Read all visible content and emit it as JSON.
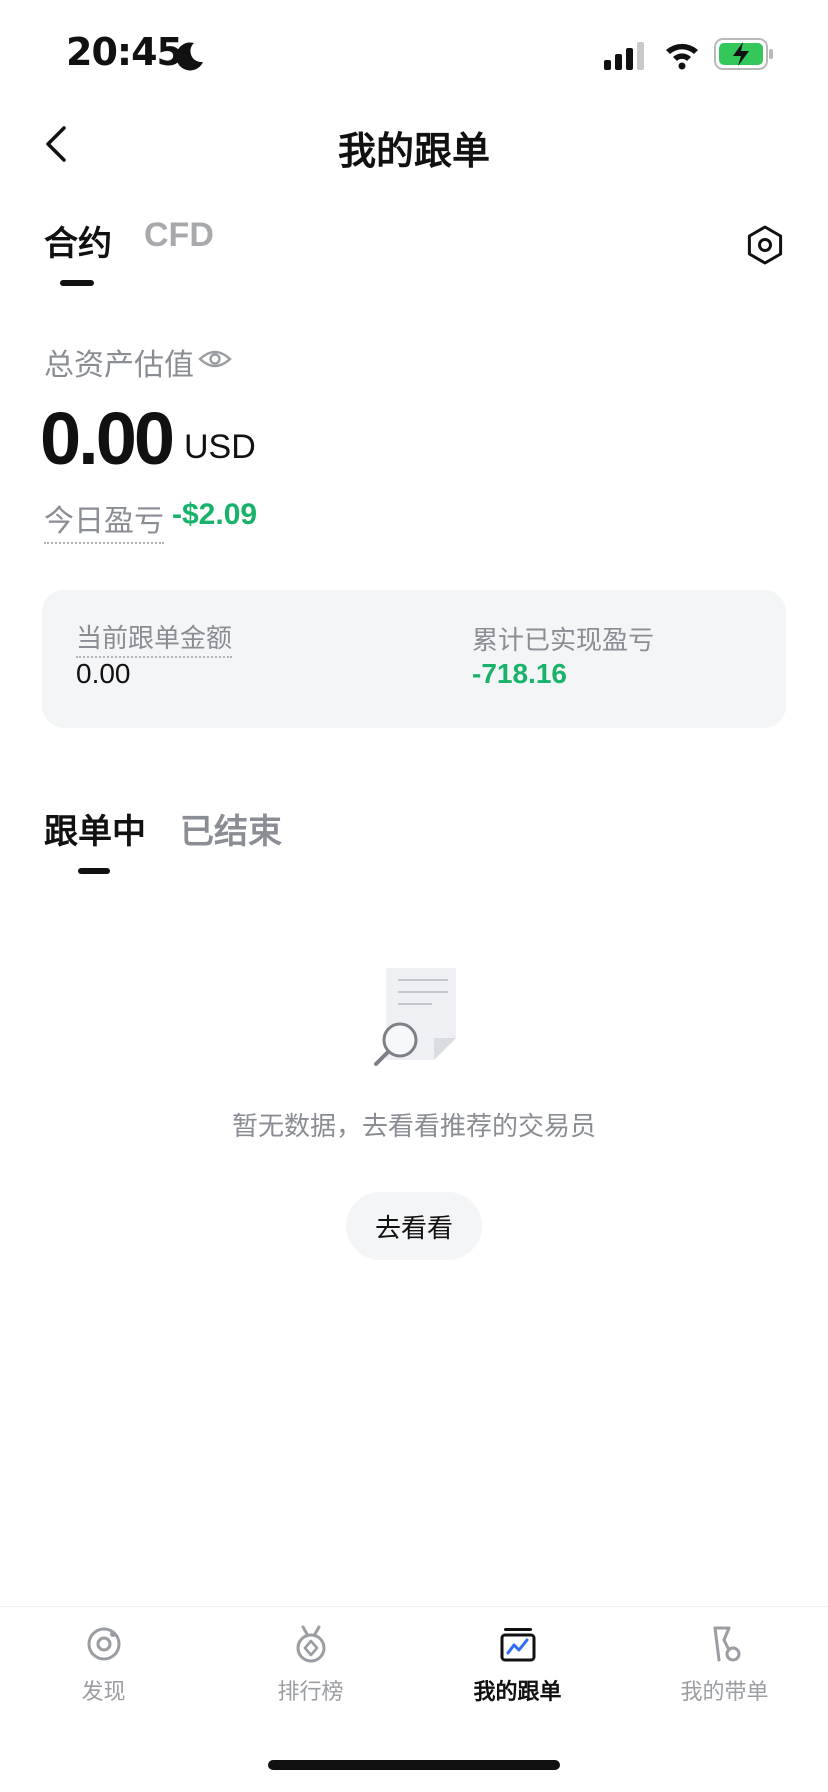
{
  "status_bar": {
    "time": "20:45"
  },
  "nav": {
    "title": "我的跟单"
  },
  "top_tabs": {
    "contract": "合约",
    "cfd": "CFD",
    "active": "合约"
  },
  "assets": {
    "total_label": "总资产估值",
    "total_value": "0.00",
    "total_unit": "USD",
    "today_pnl_label": "今日盈亏",
    "today_pnl_value": "-$2.09"
  },
  "summary_card": {
    "current_label": "当前跟单金额",
    "current_value": "0.00",
    "realized_label": "累计已实现盈亏",
    "realized_value": "-718.16"
  },
  "sub_tabs": {
    "following": "跟单中",
    "ended": "已结束",
    "active": "跟单中"
  },
  "empty_state": {
    "message": "暂无数据，去看看推荐的交易员",
    "button_label": "去看看"
  },
  "bottom_nav": {
    "items": [
      {
        "label": "发现",
        "icon": "discover-icon",
        "active": false
      },
      {
        "label": "排行榜",
        "icon": "ranking-medal-icon",
        "active": false
      },
      {
        "label": "我的跟单",
        "icon": "my-copy-trades-icon",
        "active": true
      },
      {
        "label": "我的带单",
        "icon": "my-lead-trades-icon",
        "active": false
      }
    ]
  },
  "colors": {
    "positive_green": "#18b26b",
    "card_bg": "#f4f5f6",
    "muted_text": "#8a8d93"
  }
}
